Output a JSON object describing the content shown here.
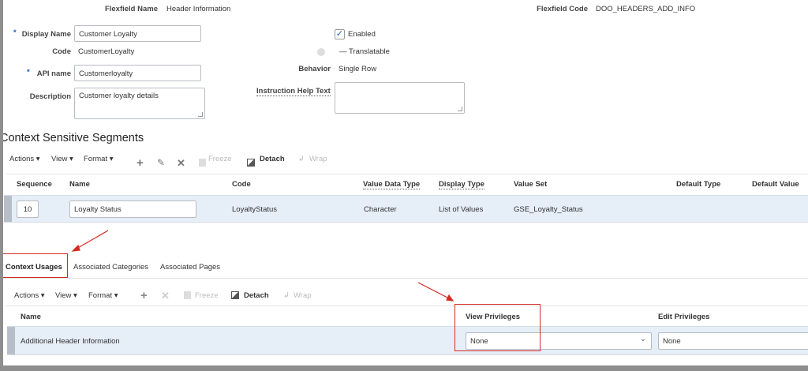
{
  "flexfield": {
    "name_label": "Flexfield Name",
    "name_value": "Header Information",
    "code_label": "Flexfield Code",
    "code_value": "DOO_HEADERS_ADD_INFO"
  },
  "form": {
    "display_name_label": "Display Name",
    "display_name_value": "Customer Loyalty",
    "code_label": "Code",
    "code_value": "CustomerLoyalty",
    "api_name_label": "API name",
    "api_name_value": "Customerloyalty",
    "description_label": "Description",
    "description_value": "Customer loyalty details",
    "required_marker": "*",
    "enabled_label": "Enabled",
    "enabled_checked": true,
    "translatable_label": "— Translatable",
    "behavior_label": "Behavior",
    "behavior_value": "Single Row",
    "instruction_label": "Instruction Help Text",
    "instruction_value": ""
  },
  "segments": {
    "title": "Context Sensitive Segments",
    "toolbar": {
      "actions": "Actions ▾",
      "view": "View ▾",
      "format": "Format ▾",
      "freeze": "Freeze",
      "detach": "Detach",
      "wrap": "Wrap"
    },
    "columns": [
      "Sequence",
      "Name",
      "Code",
      "Value Data Type",
      "Display Type",
      "Value Set",
      "Default Type",
      "Default Value"
    ],
    "rows": [
      {
        "sequence": "10",
        "name": "Loyalty Status",
        "code": "LoyaltyStatus",
        "value_data_type": "Character",
        "display_type": "List of Values",
        "value_set": "GSE_Loyalty_Status",
        "default_type": "",
        "default_value": ""
      }
    ]
  },
  "tabs": [
    "Context Usages",
    "Associated Categories",
    "Associated Pages"
  ],
  "usages": {
    "toolbar": {
      "actions": "Actions ▾",
      "view": "View ▾",
      "format": "Format ▾",
      "freeze": "Freeze",
      "detach": "Detach",
      "wrap": "Wrap"
    },
    "columns": [
      "Name",
      "View Privileges",
      "Edit Privileges"
    ],
    "rows": [
      {
        "name": "Additional Header Information",
        "view_privileges": "None",
        "edit_privileges": "None"
      }
    ]
  },
  "colors": {
    "annotation": "#d42a22",
    "row_selected": "#e6eef8",
    "accent": "#1a5fb4"
  }
}
